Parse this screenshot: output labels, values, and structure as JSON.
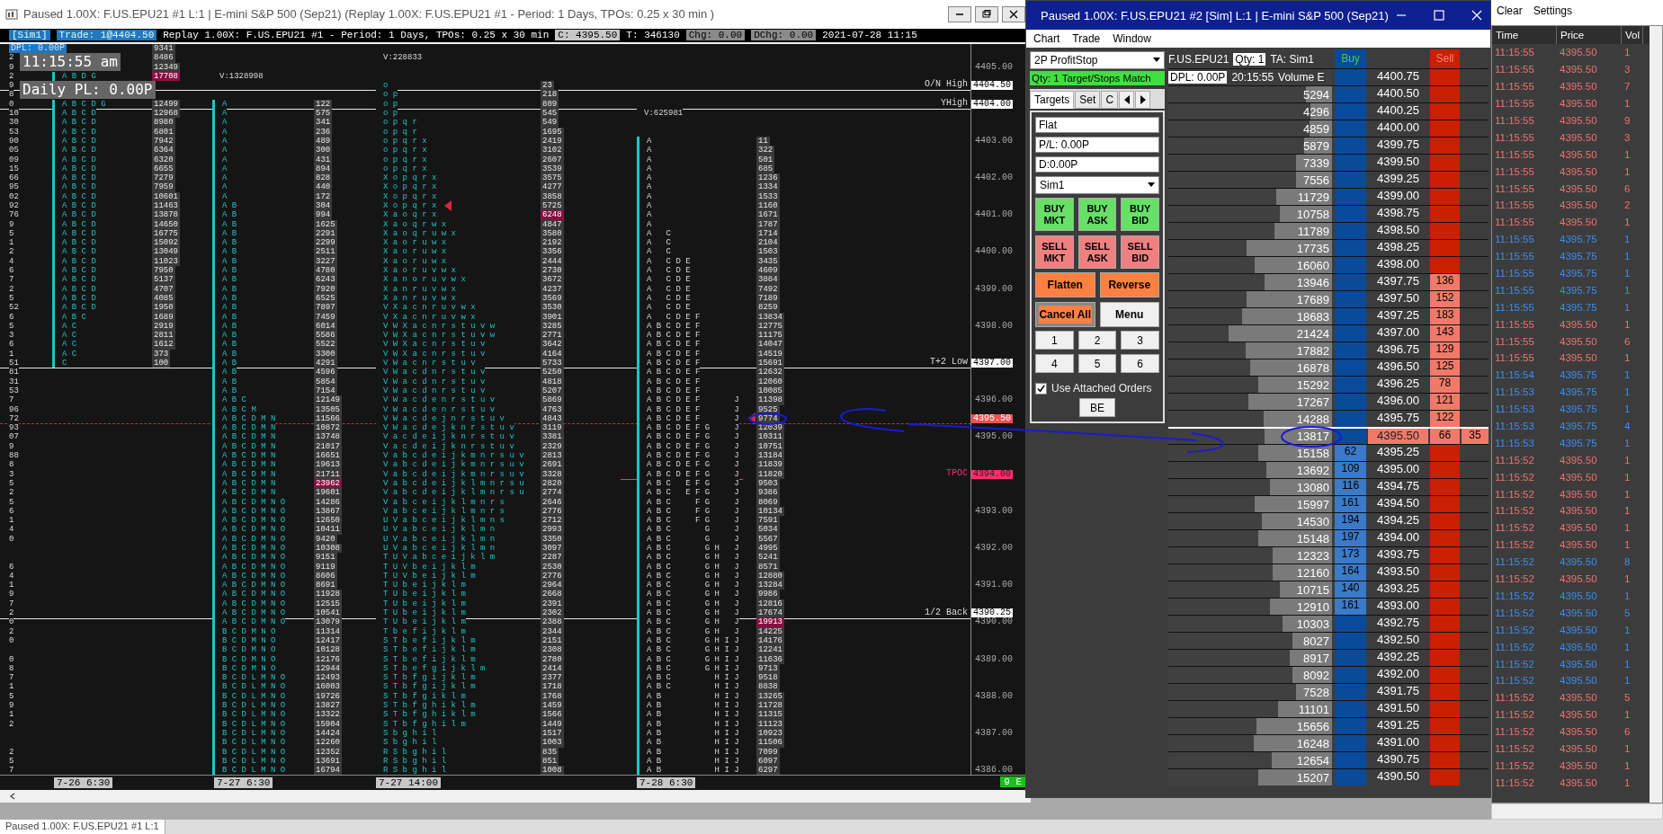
{
  "chart_window": {
    "title": "Paused 1.00X: F.US.EPU21  #1 L:1 | E-mini S&P 500 (Sep21) (Replay 1.00X: F.US.EPU21  #1 - Period: 1 Days, TPOs: 0.25 x 30 min  )",
    "info_bar": {
      "account": "[Sim1]",
      "trade": "Trade: 1@4404.50",
      "replay": "Replay 1.00X: F.US.EPU21  #1 - Period: 1 Days, TPOs: 0.25 x 30 min",
      "close": "C: 4395.50",
      "ticks": "T: 346130",
      "change": "Chg: 0.00",
      "daily_change": "DChg: 0.00",
      "datetime": "2021-07-28 11:15"
    },
    "overlays": {
      "dpl": "DPL: 0.00P",
      "clock": "11:15:55 am",
      "daily_pl": "Daily PL: 0.00P"
    },
    "columns": [
      {
        "kind": "partial"
      },
      {
        "kind": "tpo",
        "bar": true
      },
      {
        "kind": "volume"
      },
      {
        "kind": "tpo",
        "bar": true
      },
      {
        "kind": "volume"
      },
      {
        "kind": "tpo",
        "bar": false
      },
      {
        "kind": "volume"
      },
      {
        "kind": "tpo",
        "bar": true
      },
      {
        "kind": "volume"
      }
    ],
    "rows": [
      {
        "volume_1": "9341"
      },
      {
        "partial": "2",
        "volume_1": "8486",
        "tpo_3": {
          "text": "V:228833",
          "total": true
        }
      },
      {
        "partial": "9",
        "volume_1": "12349",
        "axis": {
          "text": "4405.00",
          "kind": "tick"
        }
      },
      {
        "partial": "2",
        "tpo_1": "A B D G",
        "volume_1": {
          "text": "17708",
          "poc": true
        },
        "tpo_2": {
          "text": "V:1328998",
          "total": true
        }
      },
      {
        "partial": "9",
        "tpo_3": "o",
        "volume_3": "23",
        "axis": {
          "text": "4404.50",
          "kind": "box",
          "level_line": {
            "kind": "solid",
            "label": "O/N High"
          }
        }
      },
      {
        "partial": "8",
        "tpo_3": "o p",
        "volume_3": "218"
      },
      {
        "partial": "0",
        "tpo_1": "A B C D G",
        "volume_1": "12499",
        "tpo_2": "A",
        "volume_2": "122",
        "tpo_3": "o p",
        "volume_3": "809",
        "axis": {
          "text": "4404.00",
          "kind": "box",
          "level_line": {
            "kind": "solid",
            "label": "YHigh"
          }
        }
      },
      {
        "partial": "10",
        "tpo_1": "A B C D",
        "volume_1": "12968",
        "tpo_2": "A",
        "volume_2": "575",
        "tpo_3": "o p",
        "volume_3": "545",
        "tpo_4": {
          "text": "V:625981",
          "total": true
        }
      },
      {
        "partial": "30",
        "tpo_1": "A B C D",
        "volume_1": "8980",
        "tpo_2": "A",
        "volume_2": "341",
        "tpo_3": "o p q r",
        "volume_3": "549"
      },
      {
        "partial": "53",
        "tpo_1": "A B C D",
        "volume_1": "6801",
        "tpo_2": "A",
        "volume_2": "236",
        "tpo_3": "o p q r",
        "volume_3": "1695"
      },
      {
        "partial": "90",
        "tpo_1": "A B C D",
        "volume_1": "7942",
        "tpo_2": "A",
        "volume_2": "489",
        "tpo_3": "o p q r x",
        "volume_3": "2419",
        "tpo_4": "A",
        "volume_4": "11",
        "axis": {
          "text": "4403.00",
          "kind": "tick"
        }
      },
      {
        "partial": "05",
        "tpo_1": "A B C D",
        "volume_1": "6364",
        "tpo_2": "A",
        "volume_2": "300",
        "tpo_3": "o p q r x",
        "volume_3": "3102",
        "tpo_4": "A",
        "volume_4": "322"
      },
      {
        "partial": "09",
        "tpo_1": "A B C D",
        "volume_1": "6320",
        "tpo_2": "A",
        "volume_2": "431",
        "tpo_3": "o p q r x",
        "volume_3": "2607",
        "tpo_4": "A",
        "volume_4": "501"
      },
      {
        "partial": "15",
        "tpo_1": "A B C D",
        "volume_1": "6655",
        "tpo_2": "A",
        "volume_2": "894",
        "tpo_3": "o p q r x",
        "volume_3": "3539",
        "tpo_4": "A",
        "volume_4": "685"
      },
      {
        "partial": "66",
        "tpo_1": "A B C D",
        "volume_1": "7279",
        "tpo_2": "A",
        "volume_2": "828",
        "tpo_3": "X o p q r x",
        "volume_3": "3575",
        "tpo_4": "A",
        "volume_4": "1236",
        "axis": {
          "text": "4402.00",
          "kind": "tick"
        }
      },
      {
        "partial": "95",
        "tpo_1": "A B C D",
        "volume_1": "7959",
        "tpo_2": "A",
        "volume_2": "440",
        "tpo_3": "X o p q r x",
        "volume_3": "4277",
        "tpo_4": "A",
        "volume_4": "1334"
      },
      {
        "partial": "02",
        "tpo_1": "A B C D",
        "volume_1": "10601",
        "tpo_2": "A",
        "volume_2": "172",
        "tpo_3": "X o p q r x",
        "volume_3": "3858",
        "tpo_4": "A",
        "volume_4": "1533"
      },
      {
        "partial": "92",
        "tpo_1": "A B C D",
        "volume_1": "11463",
        "tpo_2": "A B",
        "volume_2": "304",
        "tpo_3": "X o p q r x",
        "volume_3": "5725",
        "tpo_4": "A",
        "volume_4": "1160"
      },
      {
        "partial": "76",
        "tpo_1": "A B C D",
        "volume_1": "13878",
        "tpo_2": "A B",
        "volume_2": "994",
        "tpo_3": "X a o q r x",
        "volume_3": {
          "text": "6248",
          "poc": true
        },
        "tpo_4": "A",
        "volume_4": "1671",
        "axis": {
          "text": "4401.00",
          "kind": "tick"
        }
      },
      {
        "partial": "9",
        "tpo_1": "A B C D",
        "volume_1": "14650",
        "tpo_2": "A B",
        "volume_2": "1625",
        "tpo_3": "X a o q r w x",
        "volume_3": "4847",
        "tpo_4": "A",
        "volume_4": "1787"
      },
      {
        "partial": "5",
        "tpo_1": "A B C D",
        "volume_1": "16775",
        "tpo_2": "A B",
        "volume_2": "2291",
        "tpo_3": "X a o q r u w x",
        "volume_3": "3580",
        "tpo_4": "A   C",
        "volume_4": "1714"
      },
      {
        "partial": "1",
        "tpo_1": "A B C D",
        "volume_1": "15092",
        "tpo_2": "A B",
        "volume_2": "2299",
        "tpo_3": "X a o r u w x",
        "volume_3": "2192",
        "tpo_4": "A   C",
        "volume_4": "2104"
      },
      {
        "partial": "2",
        "tpo_1": "A B C D",
        "volume_1": "13049",
        "tpo_2": "A B",
        "volume_2": "2511",
        "tpo_3": "X a o r u w x",
        "volume_3": "3356",
        "tpo_4": "A   C",
        "volume_4": "1503",
        "axis": {
          "text": "4400.00",
          "kind": "tick"
        }
      },
      {
        "partial": "4",
        "tpo_1": "A B C D",
        "volume_1": "11023",
        "tpo_2": "A B",
        "volume_2": "3227",
        "tpo_3": "X a o r u w x",
        "volume_3": "2444",
        "tpo_4": "A   C D E",
        "volume_4": "3435"
      },
      {
        "partial": "6",
        "tpo_1": "A B C D",
        "volume_1": "7950",
        "tpo_2": "A B",
        "volume_2": "4780",
        "tpo_3": "X a o r u v w x",
        "volume_3": "2730",
        "tpo_4": "A   C D E",
        "volume_4": "4609"
      },
      {
        "partial": "7",
        "tpo_1": "A B C D",
        "volume_1": "5137",
        "tpo_2": "A B",
        "volume_2": "6243",
        "tpo_3": "X a n o r u v w x",
        "volume_3": "3672",
        "tpo_4": "A   C D E",
        "volume_4": "3884"
      },
      {
        "partial": "2",
        "tpo_1": "A B C D",
        "volume_1": "4707",
        "tpo_2": "A B",
        "volume_2": "7920",
        "tpo_3": "X a n r u v w x",
        "volume_3": "4237",
        "tpo_4": "A   C D E",
        "volume_4": "7492",
        "axis": {
          "text": "4399.00",
          "kind": "tick"
        }
      },
      {
        "partial": "5",
        "tpo_1": "A B C D",
        "volume_1": "4085",
        "tpo_2": "A B",
        "volume_2": "6525",
        "tpo_3": "X a n r u v w x",
        "volume_3": "3569",
        "tpo_4": "A   C D E",
        "volume_4": "7189"
      },
      {
        "partial": "52",
        "tpo_1": "A B C D",
        "volume_1": "1950",
        "tpo_2": "A B",
        "volume_2": "7897",
        "tpo_3": "V X a c n r u v w x",
        "volume_3": "3530",
        "tpo_4": "A   C D E",
        "volume_4": "8259"
      },
      {
        "partial": "6",
        "tpo_1": "A B C",
        "volume_1": "1689",
        "tpo_2": "A B",
        "volume_2": "7459",
        "tpo_3": "V X a c n r u v w x",
        "volume_3": "3901",
        "tpo_4": "A   C D E F",
        "volume_4": "13834"
      },
      {
        "partial": "5",
        "tpo_1": "A C",
        "volume_1": "2919",
        "tpo_2": "A B",
        "volume_2": "6014",
        "tpo_3": "V W X a c n r s t u v w",
        "volume_3": "3285",
        "tpo_4": "A B C D E F",
        "volume_4": "12775",
        "axis": {
          "text": "4398.00",
          "kind": "tick"
        }
      },
      {
        "partial": "3",
        "tpo_1": "A C",
        "volume_1": "2811",
        "tpo_2": "A B",
        "volume_2": "5586",
        "tpo_3": "V W X a c n r s t u v w",
        "volume_3": "2771",
        "tpo_4": "A B C D E F",
        "volume_4": "11175"
      },
      {
        "partial": "6",
        "tpo_1": "A C",
        "volume_1": "1612",
        "tpo_2": "A B",
        "volume_2": "5522",
        "tpo_3": "V W X a c n r s t u v",
        "volume_3": "3642",
        "tpo_4": "A B C D E F",
        "volume_4": "14047"
      },
      {
        "partial": "1",
        "tpo_1": "A C",
        "volume_1": "373",
        "tpo_2": "A B",
        "volume_2": "3300",
        "tpo_3": "V W X a c n r s t u v",
        "volume_3": "4164",
        "tpo_4": "A B C D E F",
        "volume_4": "14519"
      },
      {
        "partial": "51",
        "tpo_1": "C",
        "volume_1": "100",
        "tpo_2": "A B",
        "volume_2": "4291",
        "tpo_3": "V W a c n r s t u v",
        "volume_3": "5733",
        "tpo_4": "A B C D E F",
        "volume_4": "15691",
        "axis": {
          "text": "4397.00",
          "kind": "box",
          "level_line": {
            "kind": "solid",
            "label": "T+2 Low"
          }
        }
      },
      {
        "partial": "81",
        "tpo_2": "A B",
        "volume_2": "4596",
        "tpo_3": "V W a c d n r s t u v",
        "volume_3": "5250",
        "tpo_4": "A B C D E F",
        "volume_4": "12632"
      },
      {
        "partial": "31",
        "tpo_2": "A B",
        "volume_2": "5854",
        "tpo_3": "V W a c d n r s t u v",
        "volume_3": "4818",
        "tpo_4": "A B C D E F",
        "volume_4": "12060"
      },
      {
        "partial": "53",
        "tpo_2": "A B",
        "volume_2": "7154",
        "tpo_3": "V W a c d n r s t u v",
        "volume_3": "5207",
        "tpo_4": "A B C D E F",
        "volume_4": "10085"
      },
      {
        "partial": "7",
        "tpo_2": "A B C",
        "volume_2": "12149",
        "tpo_3": "V W a c d e n r s t u v",
        "volume_3": "5869",
        "tpo_4": "A B C D E F       J",
        "volume_4": "11398",
        "axis": {
          "text": "4396.00",
          "kind": "tick"
        }
      },
      {
        "partial": "96",
        "tpo_2": "A B C M",
        "volume_2": "13505",
        "tpo_3": "V W a c d e n r s t u v",
        "volume_3": "4763",
        "tpo_4": "A B C D E F       J",
        "volume_4": "9525"
      },
      {
        "partial": "72",
        "tpo_2": "A B C D M N",
        "volume_2": "11566",
        "tpo_3": "V W a c d e j n r s t u v",
        "volume_3": "4843",
        "tpo_4": "A B C D E F       J",
        "volume_4": "9774",
        "axis": {
          "text": "4395.50",
          "kind": "last",
          "level_line": {
            "kind": "dashed"
          }
        }
      },
      {
        "partial": "93",
        "tpo_2": "A B C D M N",
        "volume_2": "10872",
        "tpo_3": "V W a c d e j k n r s t u v",
        "volume_3": "3119",
        "tpo_4": "A B C D E F G     J",
        "volume_4": "12039"
      },
      {
        "partial": "07",
        "tpo_2": "A B C D M N",
        "volume_2": "13748",
        "tpo_3": "V a c d e i j k n r s t u v",
        "volume_3": "3381",
        "tpo_4": "A B C D E F G     J",
        "volume_4": "10311",
        "axis": {
          "text": "4395.00",
          "kind": "tick"
        }
      },
      {
        "partial": "9",
        "tpo_2": "A B C D M N",
        "volume_2": "21017",
        "tpo_3": "V a c d e i j k n r s t u v",
        "volume_3": "2329",
        "tpo_4": "A B C D E F G     J",
        "volume_4": "10751"
      },
      {
        "partial": "88",
        "tpo_2": "A B C D M N",
        "volume_2": "16651",
        "tpo_3": "V a b c d e i j k m n r s u v",
        "volume_3": "2813",
        "tpo_4": "A B C D E F G     J",
        "volume_4": "13184"
      },
      {
        "partial": "8",
        "tpo_2": "A B C D M N",
        "volume_2": "19613",
        "tpo_3": "V a b c d e i j k m n r s u v",
        "volume_3": "2691",
        "tpo_4": "A B C D E F G     J",
        "volume_4": "11839"
      },
      {
        "partial": "3",
        "tpo_2": "A B C D M N",
        "volume_2": "21711",
        "tpo_3": "V a b c d e i j k m n r s u v",
        "volume_3": "3328",
        "tpo_4": "A B C D E F G     J",
        "volume_4": "11820",
        "axis": {
          "text": "4394.00",
          "kind": "tpoc",
          "level_line": {
            "kind": "short",
            "label": "TPOC"
          }
        }
      },
      {
        "partial": "5",
        "tpo_2": "A B C D M N",
        "volume_2": {
          "text": "23962",
          "poc": true
        },
        "tpo_3": "V a b c d e i j k l m n r s u",
        "volume_3": "2820",
        "tpo_4": "A B C   E F G     J",
        "volume_4": "9503"
      },
      {
        "partial": "2",
        "tpo_2": "A B C D M N",
        "volume_2": "19601",
        "tpo_3": "V a b c d e i j k l m n r s u",
        "volume_3": "2774",
        "tpo_4": "A B C   E F G     J",
        "volume_4": "9386"
      },
      {
        "partial": "5",
        "tpo_2": "A B C D M N O",
        "volume_2": "14286",
        "tpo_3": "V a b c e i j k l m n r s",
        "volume_3": "2646",
        "tpo_4": "A B C     F G     J",
        "volume_4": "8069"
      },
      {
        "partial": "6",
        "tpo_2": "A B C D M N O",
        "volume_2": "13867",
        "tpo_3": "V a b c e i j k l m n r s",
        "volume_3": "2776",
        "tpo_4": "A B C     F G     J",
        "volume_4": "10134",
        "axis": {
          "text": "4393.00",
          "kind": "tick"
        }
      },
      {
        "partial": "1",
        "tpo_2": "A B C D M N O",
        "volume_2": "12650",
        "tpo_3": "U V a b c e i j k l m n s",
        "volume_3": "2712",
        "tpo_4": "A B C     F G     J",
        "volume_4": "7591"
      },
      {
        "partial": "4",
        "tpo_2": "A B C D M N O",
        "volume_2": "10411",
        "tpo_3": "U V a b c e i j k l m n",
        "volume_3": "2993",
        "tpo_4": "A B C       G     J",
        "volume_4": "5034"
      },
      {
        "partial": "0",
        "tpo_2": "A B C D M N O",
        "volume_2": "9420",
        "tpo_3": "U V a b c e i j k l m n",
        "volume_3": "3350",
        "tpo_4": "A B C       G     J",
        "volume_4": "5567"
      },
      {
        "tpo_2": "A B C D M N O",
        "volume_2": "10308",
        "tpo_3": "U V a b c e i j k l m n",
        "volume_3": "3097",
        "tpo_4": "A B C       G H   J",
        "volume_4": "4995",
        "axis": {
          "text": "4392.00",
          "kind": "tick"
        }
      },
      {
        "tpo_2": "A B C D M N O",
        "volume_2": "9151",
        "tpo_3": "T U V a b c e i j k l m",
        "volume_3": "2287",
        "tpo_4": "A B C       G H   J",
        "volume_4": "5241"
      },
      {
        "partial": "6",
        "tpo_2": "A B C D M N O",
        "volume_2": "9119",
        "tpo_3": "T U V b e i j k l m",
        "volume_3": "2530",
        "tpo_4": "A B C       G H   J",
        "volume_4": "8571"
      },
      {
        "partial": "4",
        "tpo_2": "A B C D M N O",
        "volume_2": "8606",
        "tpo_3": "T U V b e i j k l m",
        "volume_3": "2776",
        "tpo_4": "A B C       G H   J",
        "volume_4": "12880"
      },
      {
        "partial": "1",
        "tpo_2": "A B C D M N O",
        "volume_2": "8691",
        "tpo_3": "T U b e i j k l m",
        "volume_3": "2964",
        "tpo_4": "A B C       G H   J",
        "volume_4": "13284",
        "axis": {
          "text": "4391.00",
          "kind": "tick"
        }
      },
      {
        "partial": "9",
        "tpo_2": "A B C D M N O",
        "volume_2": "11928",
        "tpo_3": "T U b e i j k l m",
        "volume_3": "2668",
        "tpo_4": "A B C       G H   J",
        "volume_4": "9986"
      },
      {
        "partial": "7",
        "tpo_2": "A B C D M N O",
        "volume_2": "12515",
        "tpo_3": "T U b e i j k l m",
        "volume_3": "2391",
        "tpo_4": "A B C       G H   J",
        "volume_4": "12816"
      },
      {
        "partial": "2",
        "tpo_2": "A B C D M N O",
        "volume_2": "10541",
        "tpo_3": "T U b e i j k l m",
        "volume_3": "2302",
        "tpo_4": "A B C       G H   J",
        "volume_4": "17674",
        "axis": {
          "text": "4390.25",
          "kind": "box",
          "level_line": {
            "kind": "solid",
            "label": "1/2 Back"
          }
        }
      },
      {
        "partial": "0",
        "tpo_2": "A B C D M N O",
        "volume_2": "13079",
        "tpo_3": "T U b e i j k l m",
        "volume_3": "2388",
        "tpo_4": "A B C       G H   J",
        "volume_4": {
          "text": "19913",
          "poc": true
        },
        "axis": {
          "text": "4390.00",
          "kind": "tick"
        }
      },
      {
        "partial": "2",
        "tpo_2": "B C D M N O",
        "volume_2": "11314",
        "tpo_3": "T b e f i j k l m",
        "volume_3": "2344",
        "tpo_4": "A B C       G H   J",
        "volume_4": "14225"
      },
      {
        "partial": "0",
        "tpo_2": "B C D M N O",
        "volume_2": "12417",
        "tpo_3": "S T b e f i j k l m",
        "volume_3": "2151",
        "tpo_4": "A B C       G H I J",
        "volume_4": "14176"
      },
      {
        "tpo_2": "B C D M N O",
        "volume_2": "10128",
        "tpo_3": "S T b e f i j k l m",
        "volume_3": "2308",
        "tpo_4": "A B C       G H I J",
        "volume_4": "12241"
      },
      {
        "partial": "0",
        "tpo_2": "B C D M N O",
        "volume_2": "12176",
        "tpo_3": "S T b e f i j k l m",
        "volume_3": "2780",
        "tpo_4": "A B C       G H I J",
        "volume_4": "11636",
        "axis": {
          "text": "4389.00",
          "kind": "tick"
        }
      },
      {
        "partial": "8",
        "tpo_2": "B C D M N O",
        "volume_2": "12944",
        "tpo_3": "S T b e f g i j k l m",
        "volume_3": "2414",
        "tpo_4": "A B C       G H I J",
        "volume_4": "9713"
      },
      {
        "partial": "7",
        "tpo_2": "B C D L M N O",
        "volume_2": "12493",
        "tpo_3": "S T b f g i j k l m",
        "volume_3": "2377",
        "tpo_4": "A B C         H I J",
        "volume_4": "9518"
      },
      {
        "partial": "1",
        "tpo_2": "B C D L M N O",
        "volume_2": "16003",
        "tpo_3": "S T b f g i j k l m",
        "volume_3": "1718",
        "tpo_4": "A B C         H I J",
        "volume_4": "8838"
      },
      {
        "partial": "5",
        "tpo_2": "B C D L M N O",
        "volume_2": "19726",
        "tpo_3": "S T b f g i k l m",
        "volume_3": "1768",
        "tpo_4": "A B           H I J",
        "volume_4": "13265",
        "axis": {
          "text": "4388.00",
          "kind": "tick"
        }
      },
      {
        "partial": "9",
        "tpo_2": "B C D L M N O",
        "volume_2": "13827",
        "tpo_3": "S T b f g h i k l m",
        "volume_3": "1459",
        "tpo_4": "A B           H I J",
        "volume_4": "11728"
      },
      {
        "partial": "1",
        "tpo_2": "B C D L M N O",
        "volume_2": "13322",
        "tpo_3": "S T b f g h i k l m",
        "volume_3": "1566",
        "tpo_4": "A B           H I J",
        "volume_4": "11315"
      },
      {
        "partial": "2",
        "tpo_2": "B C D L M N O",
        "volume_2": "15904",
        "tpo_3": "S T b f g h i l m",
        "volume_3": "1449",
        "tpo_4": "A B           H I J",
        "volume_4": "11123"
      },
      {
        "tpo_2": "B C D L M N O",
        "volume_2": "14424",
        "tpo_3": "S b g h i l",
        "volume_3": "1517",
        "tpo_4": "A B           H I J",
        "volume_4": "10923",
        "axis": {
          "text": "4387.00",
          "kind": "tick"
        }
      },
      {
        "tpo_2": "B C D L M N O",
        "volume_2": "12260",
        "tpo_3": "S b g h i l",
        "volume_3": "1003",
        "tpo_4": "A B           H I J",
        "volume_4": "11506"
      },
      {
        "partial": "2",
        "tpo_2": "B C D L M N O",
        "volume_2": "12352",
        "tpo_3": "R S b g h i l",
        "volume_3": "835",
        "tpo_4": "A B           H I J",
        "volume_4": "7099"
      },
      {
        "partial": "5",
        "tpo_2": "B C D L M N O",
        "volume_2": "13691",
        "tpo_3": "R S b g h i l",
        "volume_3": "851",
        "tpo_4": "A B           H I J",
        "volume_4": "6097"
      },
      {
        "partial": "7",
        "tpo_2": "B C D L M N O",
        "volume_2": "16794",
        "tpo_3": "R S b g h i l",
        "volume_3": "1008",
        "tpo_4": "A B           H I J",
        "volume_4": "6297",
        "axis": {
          "text": "4386.00",
          "kind": "tick"
        }
      }
    ],
    "date_bar": [
      "7-26  6:30",
      "7-27  6:30",
      "7-27  14:00",
      "7-28  6:30"
    ],
    "status_badge": "9 E"
  },
  "dom_window": {
    "title": "Paused 1.00X: F.US.EPU21  #2 [Sim]  L:1 | E-mini S&P 500 (Sep21)",
    "menu": [
      "Chart",
      "Trade",
      "Window"
    ],
    "strategy": "2P ProfitStop",
    "match_status": "Qty: 1 Target/Stops Match",
    "tabs": [
      {
        "label": "Targets",
        "selected": true
      },
      {
        "label": "Set",
        "selected": false
      },
      {
        "label": "C",
        "selected": false
      }
    ],
    "fields": [
      "Flat",
      "P/L: 0.00P",
      "D:0.00P"
    ],
    "account": "Sim1",
    "order_buttons": [
      {
        "label": "BUY MKT",
        "kind": "buy"
      },
      {
        "label": "BUY ASK",
        "kind": "buy"
      },
      {
        "label": "BUY BID",
        "kind": "buy"
      },
      {
        "label": "SELL MKT",
        "kind": "sell"
      },
      {
        "label": "SELL ASK",
        "kind": "sell"
      },
      {
        "label": "SELL BID",
        "kind": "sell"
      }
    ],
    "action_buttons": [
      {
        "label": "Flatten",
        "kind": "accent"
      },
      {
        "label": "Reverse",
        "kind": "accent"
      },
      {
        "label": "Cancel All",
        "kind": "cancel"
      },
      {
        "label": "Menu",
        "kind": "plain"
      }
    ],
    "quantity_buttons": [
      "1",
      "2",
      "3",
      "4",
      "5",
      "6"
    ],
    "attached_orders": {
      "label": "Use Attached Orders",
      "checked": true
    },
    "be_button": "BE",
    "header": {
      "symbol": "F.US.EPU21",
      "qty": "Qty: 1",
      "account": "TA: Sim1",
      "dpl": "DPL: 0.00P",
      "time": "20:15:55",
      "volume": "Volume E",
      "buy": "Buy",
      "sell": "Sell"
    },
    "rows": [
      {
        "price": "4400.75",
        "current": false
      },
      {
        "price": "4400.50",
        "volume": "5294",
        "level": 0.16,
        "current": false
      },
      {
        "price": "4400.25",
        "volume": "4296",
        "level": 0.13,
        "current": false
      },
      {
        "price": "4400.00",
        "volume": "4859",
        "level": 0.14,
        "current": false
      },
      {
        "price": "4399.75",
        "volume": "5879",
        "level": 0.17,
        "current": false
      },
      {
        "price": "4399.50",
        "volume": "7339",
        "level": 0.22,
        "current": false
      },
      {
        "price": "4399.25",
        "volume": "7556",
        "level": 0.22,
        "current": false
      },
      {
        "price": "4399.00",
        "volume": "11729",
        "level": 0.34,
        "current": false
      },
      {
        "price": "4398.75",
        "volume": "10758",
        "level": 0.32,
        "current": false
      },
      {
        "price": "4398.50",
        "volume": "11789",
        "level": 0.35,
        "current": false
      },
      {
        "price": "4398.25",
        "volume": "17735",
        "level": 0.52,
        "current": false
      },
      {
        "price": "4398.00",
        "volume": "16060",
        "level": 0.47,
        "current": false
      },
      {
        "price": "4397.75",
        "volume": "13946",
        "level": 0.41,
        "ask": "136",
        "current": false
      },
      {
        "price": "4397.50",
        "volume": "17689",
        "level": 0.52,
        "ask": "152",
        "current": false
      },
      {
        "price": "4397.25",
        "volume": "18683",
        "level": 0.55,
        "ask": "183",
        "current": false
      },
      {
        "price": "4397.00",
        "volume": "21424",
        "level": 0.63,
        "ask": "143",
        "current": false
      },
      {
        "price": "4396.75",
        "volume": "17882",
        "level": 0.53,
        "ask": "129",
        "current": false
      },
      {
        "price": "4396.50",
        "volume": "16878",
        "level": 0.5,
        "ask": "125",
        "current": false
      },
      {
        "price": "4396.25",
        "volume": "15292",
        "level": 0.45,
        "ask": "78",
        "current": false
      },
      {
        "price": "4396.00",
        "volume": "17267",
        "level": 0.51,
        "ask": "121",
        "current": false
      },
      {
        "price": "4395.75",
        "volume": "14288",
        "level": 0.42,
        "ask": "122",
        "current": false
      },
      {
        "price": "4395.50",
        "volume": "13817",
        "level": 0.41,
        "ask": "66",
        "traded": "35",
        "current": true
      },
      {
        "price": "4395.25",
        "volume": "15158",
        "level": 0.45,
        "bid": "62",
        "current": false
      },
      {
        "price": "4395.00",
        "volume": "13692",
        "level": 0.4,
        "bid": "109",
        "current": false
      },
      {
        "price": "4394.75",
        "volume": "13080",
        "level": 0.38,
        "bid": "116",
        "current": false
      },
      {
        "price": "4394.50",
        "volume": "15997",
        "level": 0.47,
        "bid": "161",
        "current": false
      },
      {
        "price": "4394.25",
        "volume": "14530",
        "level": 0.43,
        "bid": "194",
        "current": false
      },
      {
        "price": "4394.00",
        "volume": "15148",
        "level": 0.45,
        "bid": "197",
        "current": false
      },
      {
        "price": "4393.75",
        "volume": "12323",
        "level": 0.36,
        "bid": "173",
        "current": false
      },
      {
        "price": "4393.50",
        "volume": "12160",
        "level": 0.36,
        "bid": "164",
        "current": false
      },
      {
        "price": "4393.25",
        "volume": "10715",
        "level": 0.32,
        "bid": "140",
        "current": false
      },
      {
        "price": "4393.00",
        "volume": "12910",
        "level": 0.38,
        "bid": "161",
        "current": false
      },
      {
        "price": "4392.75",
        "volume": "10303",
        "level": 0.3,
        "current": false
      },
      {
        "price": "4392.50",
        "volume": "8027",
        "level": 0.24,
        "current": false
      },
      {
        "price": "4392.25",
        "volume": "8917",
        "level": 0.26,
        "current": false
      },
      {
        "price": "4392.00",
        "volume": "8092",
        "level": 0.24,
        "current": false
      },
      {
        "price": "4391.75",
        "volume": "7528",
        "level": 0.22,
        "current": false
      },
      {
        "price": "4391.50",
        "volume": "11101",
        "level": 0.33,
        "current": false
      },
      {
        "price": "4391.25",
        "volume": "15656",
        "level": 0.46,
        "current": false
      },
      {
        "price": "4391.00",
        "volume": "16248",
        "level": 0.48,
        "current": false
      },
      {
        "price": "4390.75",
        "volume": "12654",
        "level": 0.37,
        "current": false
      },
      {
        "price": "4390.50",
        "volume": "15207",
        "level": 0.45,
        "current": false
      }
    ]
  },
  "time_and_sales": {
    "menu": [
      "Clear",
      "Settings"
    ],
    "columns": [
      "Time",
      "Price",
      "Vol"
    ],
    "rows": [
      {
        "time": "11:15:55",
        "price": "4395.50",
        "vol": "1",
        "color": "#f07272"
      },
      {
        "time": "11:15:55",
        "price": "4395.50",
        "vol": "3",
        "color": "#f07272"
      },
      {
        "time": "11:15:55",
        "price": "4395.50",
        "vol": "7",
        "color": "#f07272"
      },
      {
        "time": "11:15:55",
        "price": "4395.50",
        "vol": "1",
        "color": "#f07272"
      },
      {
        "time": "11:15:55",
        "price": "4395.50",
        "vol": "9",
        "color": "#f07272"
      },
      {
        "time": "11:15:55",
        "price": "4395.50",
        "vol": "3",
        "color": "#f07272"
      },
      {
        "time": "11:15:55",
        "price": "4395.50",
        "vol": "1",
        "color": "#f07272"
      },
      {
        "time": "11:15:55",
        "price": "4395.50",
        "vol": "1",
        "color": "#f07272"
      },
      {
        "time": "11:15:55",
        "price": "4395.50",
        "vol": "6",
        "color": "#f07272"
      },
      {
        "time": "11:15:55",
        "price": "4395.50",
        "vol": "2",
        "color": "#f07272"
      },
      {
        "time": "11:15:55",
        "price": "4395.50",
        "vol": "1",
        "color": "#f07272"
      },
      {
        "time": "11:15:55",
        "price": "4395.75",
        "vol": "1",
        "color": "#3b8ef0"
      },
      {
        "time": "11:15:55",
        "price": "4395.75",
        "vol": "1",
        "color": "#3b8ef0"
      },
      {
        "time": "11:15:55",
        "price": "4395.75",
        "vol": "1",
        "color": "#3b8ef0"
      },
      {
        "time": "11:15:55",
        "price": "4395.75",
        "vol": "1",
        "color": "#3b8ef0"
      },
      {
        "time": "11:15:55",
        "price": "4395.75",
        "vol": "1",
        "color": "#3b8ef0"
      },
      {
        "time": "11:15:55",
        "price": "4395.50",
        "vol": "1",
        "color": "#f07272"
      },
      {
        "time": "11:15:55",
        "price": "4395.50",
        "vol": "6",
        "color": "#f07272"
      },
      {
        "time": "11:15:55",
        "price": "4395.50",
        "vol": "1",
        "color": "#f07272"
      },
      {
        "time": "11:15:54",
        "price": "4395.75",
        "vol": "1",
        "color": "#3b8ef0"
      },
      {
        "time": "11:15:53",
        "price": "4395.75",
        "vol": "1",
        "color": "#3b8ef0"
      },
      {
        "time": "11:15:53",
        "price": "4395.75",
        "vol": "1",
        "color": "#3b8ef0"
      },
      {
        "time": "11:15:53",
        "price": "4395.75",
        "vol": "4",
        "color": "#3b8ef0"
      },
      {
        "time": "11:15:53",
        "price": "4395.75",
        "vol": "1",
        "color": "#3b8ef0"
      },
      {
        "time": "11:15:52",
        "price": "4395.50",
        "vol": "1",
        "color": "#f07272"
      },
      {
        "time": "11:15:52",
        "price": "4395.50",
        "vol": "1",
        "color": "#f07272"
      },
      {
        "time": "11:15:52",
        "price": "4395.50",
        "vol": "1",
        "color": "#f07272"
      },
      {
        "time": "11:15:52",
        "price": "4395.50",
        "vol": "1",
        "color": "#f07272"
      },
      {
        "time": "11:15:52",
        "price": "4395.50",
        "vol": "1",
        "color": "#f07272"
      },
      {
        "time": "11:15:52",
        "price": "4395.50",
        "vol": "1",
        "color": "#f07272"
      },
      {
        "time": "11:15:52",
        "price": "4395.50",
        "vol": "8",
        "color": "#3b8ef0"
      },
      {
        "time": "11:15:52",
        "price": "4395.50",
        "vol": "1",
        "color": "#f07272"
      },
      {
        "time": "11:15:52",
        "price": "4395.50",
        "vol": "1",
        "color": "#3b8ef0"
      },
      {
        "time": "11:15:52",
        "price": "4395.50",
        "vol": "5",
        "color": "#3b8ef0"
      },
      {
        "time": "11:15:52",
        "price": "4395.50",
        "vol": "1",
        "color": "#3b8ef0"
      },
      {
        "time": "11:15:52",
        "price": "4395.50",
        "vol": "1",
        "color": "#3b8ef0"
      },
      {
        "time": "11:15:52",
        "price": "4395.50",
        "vol": "1",
        "color": "#3b8ef0"
      },
      {
        "time": "11:15:52",
        "price": "4395.50",
        "vol": "1",
        "color": "#3b8ef0"
      },
      {
        "time": "11:15:52",
        "price": "4395.50",
        "vol": "5",
        "color": "#f07272"
      },
      {
        "time": "11:15:52",
        "price": "4395.50",
        "vol": "1",
        "color": "#f07272"
      },
      {
        "time": "11:15:52",
        "price": "4395.50",
        "vol": "6",
        "color": "#f07272"
      },
      {
        "time": "11:15:52",
        "price": "4395.50",
        "vol": "1",
        "color": "#f07272"
      },
      {
        "time": "11:15:52",
        "price": "4395.50",
        "vol": "1",
        "color": "#f07272"
      },
      {
        "time": "11:15:52",
        "price": "4395.50",
        "vol": "1",
        "color": "#f07272"
      }
    ]
  },
  "taskbar": {
    "item": "Paused 1.00X: F.US.EPU21  #1 L:1"
  }
}
